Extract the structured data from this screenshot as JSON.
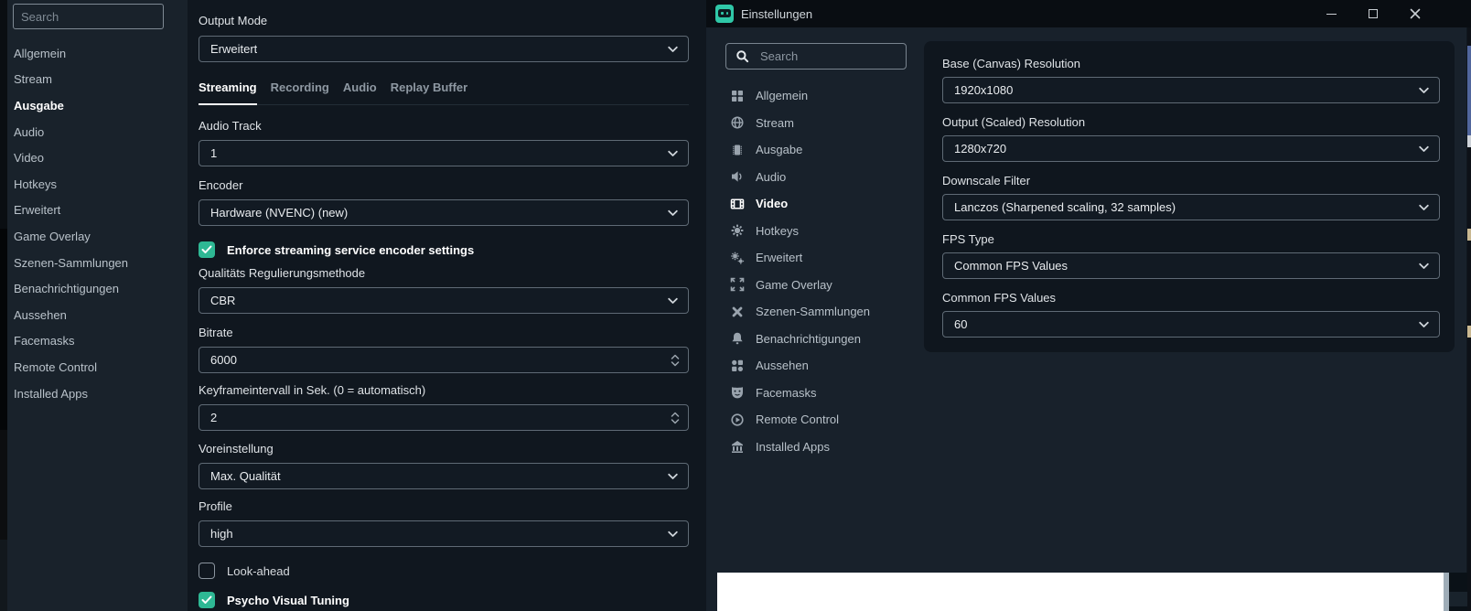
{
  "left_window": {
    "search": {
      "placeholder": "Search"
    },
    "nav": {
      "items": [
        "Allgemein",
        "Stream",
        "Ausgabe",
        "Audio",
        "Video",
        "Hotkeys",
        "Erweitert",
        "Game Overlay",
        "Szenen-Sammlungen",
        "Benachrichtigungen",
        "Aussehen",
        "Facemasks",
        "Remote Control",
        "Installed Apps"
      ],
      "active": "Ausgabe"
    },
    "content": {
      "output_mode": {
        "label": "Output Mode",
        "value": "Erweitert"
      },
      "tabs": {
        "items": [
          "Streaming",
          "Recording",
          "Audio",
          "Replay Buffer"
        ],
        "active": "Streaming"
      },
      "audio_track": {
        "label": "Audio Track",
        "value": "1"
      },
      "encoder": {
        "label": "Encoder",
        "value": "Hardware (NVENC) (new)"
      },
      "enforce": {
        "label": "Enforce streaming service encoder settings",
        "checked": true
      },
      "rate_control": {
        "label": "Qualitäts Regulierungsmethode",
        "value": "CBR"
      },
      "bitrate": {
        "label": "Bitrate",
        "value": "6000"
      },
      "keyframe_interval": {
        "label": "Keyframeintervall in Sek. (0 = automatisch)",
        "value": "2"
      },
      "preset": {
        "label": "Voreinstellung",
        "value": "Max. Qualität"
      },
      "profile": {
        "label": "Profile",
        "value": "high"
      },
      "look_ahead": {
        "label": "Look-ahead",
        "checked": false
      },
      "psycho_visual_tuning": {
        "label": "Psycho Visual Tuning",
        "checked": true
      }
    }
  },
  "right_window": {
    "titlebar": {
      "title": "Einstellungen"
    },
    "search": {
      "placeholder": "Search"
    },
    "nav": {
      "items": [
        {
          "label": "Allgemein",
          "icon": "grid-icon"
        },
        {
          "label": "Stream",
          "icon": "globe-icon"
        },
        {
          "label": "Ausgabe",
          "icon": "chip-icon"
        },
        {
          "label": "Audio",
          "icon": "speaker-icon"
        },
        {
          "label": "Video",
          "icon": "film-icon"
        },
        {
          "label": "Hotkeys",
          "icon": "gear-icon"
        },
        {
          "label": "Erweitert",
          "icon": "gears-icon"
        },
        {
          "label": "Game Overlay",
          "icon": "expand-icon"
        },
        {
          "label": "Szenen-Sammlungen",
          "icon": "crossed-tools-icon"
        },
        {
          "label": "Benachrichtigungen",
          "icon": "bell-icon"
        },
        {
          "label": "Aussehen",
          "icon": "shapes-icon"
        },
        {
          "label": "Facemasks",
          "icon": "mask-icon"
        },
        {
          "label": "Remote Control",
          "icon": "play-circle-icon"
        },
        {
          "label": "Installed Apps",
          "icon": "store-icon"
        }
      ],
      "active": "Video"
    },
    "video_panel": {
      "fields": [
        {
          "label": "Base (Canvas) Resolution",
          "value": "1920x1080"
        },
        {
          "label": "Output (Scaled) Resolution",
          "value": "1280x720"
        },
        {
          "label": "Downscale Filter",
          "value": "Lanczos (Sharpened scaling, 32 samples)"
        },
        {
          "label": "FPS Type",
          "value": "Common FPS Values"
        },
        {
          "label": "Common FPS Values",
          "value": "60"
        }
      ]
    }
  },
  "colors": {
    "accent_teal": "#2eb894",
    "titlebar": "#090d12",
    "window_body": "#18212b",
    "content_panel": "#0f161e",
    "left_sidebar": "#19222b",
    "left_content": "#10171f",
    "field_border": "#5f6a75",
    "white_overlay": "#ffffff",
    "sliver_blue": "#51669c",
    "sliver_tan": "#c9b891"
  }
}
